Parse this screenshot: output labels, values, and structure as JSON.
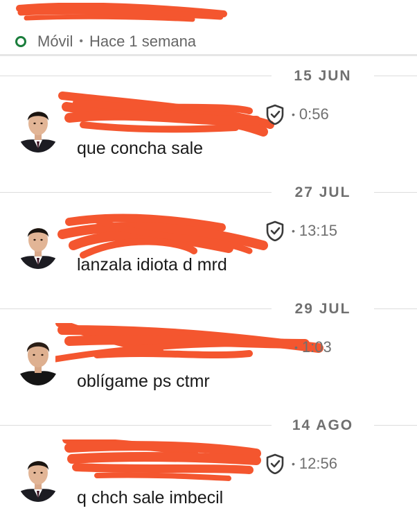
{
  "header": {
    "status_label": "Móvil",
    "separator": "•",
    "last_seen": "Hace 1 semana"
  },
  "colors": {
    "online_dot": "#1a7d3c",
    "redaction": "#f4562f",
    "date_text": "#707070",
    "meta_text": "#707070"
  },
  "messages": [
    {
      "date": "15 JUN",
      "time": "0:56",
      "text": "que concha sale",
      "avatar": "avatar-man-suit",
      "verified_icon": "shield-check-icon"
    },
    {
      "date": "27 JUL",
      "time": "13:15",
      "text": "lanzala idiota d mrd",
      "avatar": "avatar-man-suit",
      "verified_icon": "shield-check-icon"
    },
    {
      "date": "29 JUL",
      "time": "1:03",
      "text": "oblígame ps ctmr",
      "avatar": "avatar-man-casual",
      "verified_icon": ""
    },
    {
      "date": "14 AGO",
      "time": "12:56",
      "text": "q chch sale imbecil",
      "avatar": "avatar-man-suit",
      "verified_icon": "shield-check-icon"
    }
  ]
}
